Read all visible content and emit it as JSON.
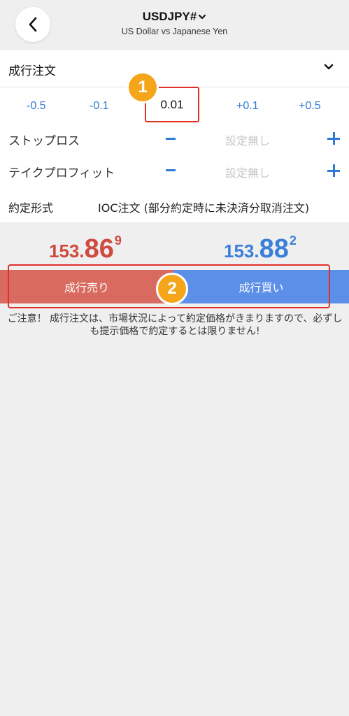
{
  "header": {
    "title": "USDJPY#",
    "subtitle": "US Dollar vs Japanese Yen"
  },
  "order_type": {
    "label": "成行注文"
  },
  "volume": {
    "steps": [
      "-0.5",
      "-0.1",
      "+0.1",
      "+0.5"
    ],
    "value": "0.01"
  },
  "stop_loss": {
    "label": "ストップロス",
    "value": "設定無し"
  },
  "take_profit": {
    "label": "テイクプロフィット",
    "value": "設定無し"
  },
  "fill_policy": {
    "label": "約定形式",
    "value": "IOC注文 (部分約定時に未決済分取消注文)"
  },
  "prices": {
    "bid": {
      "small": "153.",
      "big": "86",
      "sup": "9"
    },
    "ask": {
      "small": "153.",
      "big": "88",
      "sup": "2"
    }
  },
  "buttons": {
    "sell": "成行売り",
    "buy": "成行買い"
  },
  "badges": [
    "1",
    "2"
  ],
  "notice": "ご注意！ 成行注文は、市場状況によって約定価格がきまりますので、必ずしも提示価格で約定するとは限りません!",
  "colors": {
    "accent_blue": "#2f7ad6",
    "sell_red": "#d96a60",
    "buy_blue": "#5b8fe8",
    "annotation_red": "#e0302a",
    "badge_orange": "#f5a51a"
  }
}
